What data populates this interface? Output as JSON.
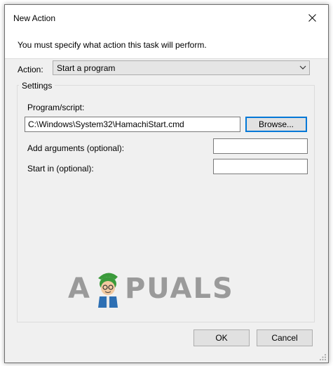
{
  "window": {
    "title": "New Action"
  },
  "banner": {
    "text": "You must specify what action this task will perform."
  },
  "action": {
    "label": "Action:",
    "selected": "Start a program"
  },
  "settings": {
    "legend": "Settings",
    "program_label": "Program/script:",
    "program_value": "C:\\Windows\\System32\\HamachiStart.cmd",
    "browse_label": "Browse...",
    "args_label": "Add arguments (optional):",
    "args_value": "",
    "startin_label": "Start in (optional):",
    "startin_value": ""
  },
  "watermark": {
    "left": "A",
    "right": "PUALS"
  },
  "buttons": {
    "ok": "OK",
    "cancel": "Cancel"
  },
  "icons": {
    "close": "close-icon",
    "dropdown": "chevron-down-icon",
    "grip": "resize-grip-icon",
    "mascot": "appuals-mascot-logo"
  },
  "colors": {
    "dialog_bg": "#f0f0f0",
    "focus_border": "#0078d7",
    "watermark": "#9a9a9a",
    "mascot_hat": "#3a9a3a"
  }
}
